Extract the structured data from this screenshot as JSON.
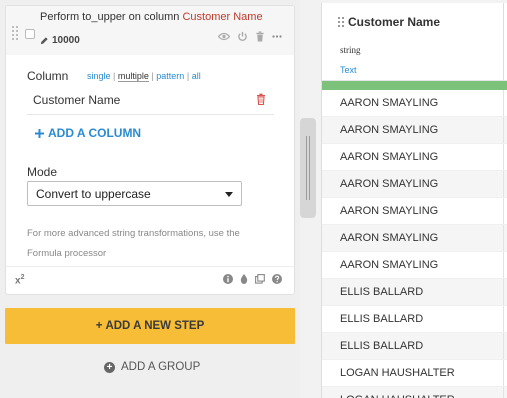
{
  "step": {
    "title_prefix": "Perform to_upper on column",
    "title_column": "Customer Name",
    "count": "10000",
    "column_label": "Column",
    "column_modes": [
      "single",
      "multiple",
      "pattern",
      "all"
    ],
    "column_value": "Customer Name",
    "add_column_label": "ADD A COLUMN",
    "mode_label": "Mode",
    "mode_value": "Convert to uppercase",
    "help_text": "For more advanced string transformations, use the Formula processor",
    "footer_badge": "x",
    "footer_badge_sup": "2"
  },
  "actions": {
    "add_step_label": "ADD A NEW STEP",
    "add_group_label": "ADD A GROUP"
  },
  "table": {
    "column_name": "Customer Name",
    "storage_type": "string",
    "meaning": "Text",
    "colors": {
      "quality_valid": "#7cc27a",
      "accent_blue": "#2b8bd1",
      "add_step_yellow": "#f8bd36",
      "column_red": "#c0392b"
    },
    "rows": [
      "AARON SMAYLING",
      "AARON SMAYLING",
      "AARON SMAYLING",
      "AARON SMAYLING",
      "AARON SMAYLING",
      "AARON SMAYLING",
      "AARON SMAYLING",
      "ELLIS BALLARD",
      "ELLIS BALLARD",
      "ELLIS BALLARD",
      "LOGAN HAUSHALTER",
      "LOGAN HAUSHALTER"
    ]
  }
}
